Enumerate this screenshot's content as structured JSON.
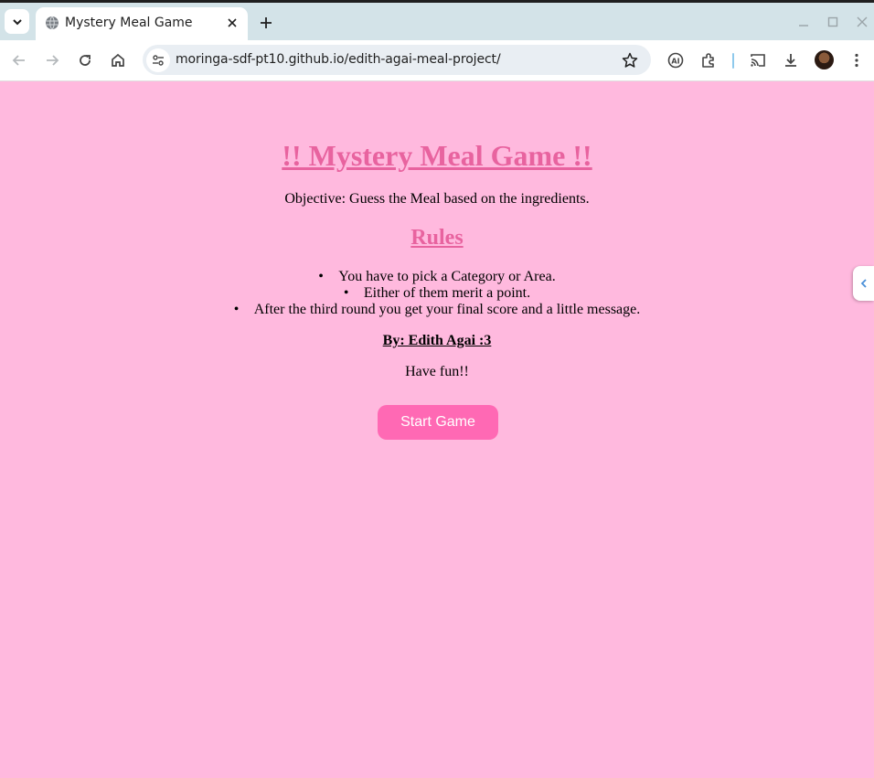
{
  "browser": {
    "tab_title": "Mystery Meal Game",
    "url": "moringa-sdf-pt10.github.io/edith-agai-meal-project/",
    "accent": "#d3e3e8"
  },
  "page": {
    "title": "!! Mystery Meal Game !!",
    "objective": "Objective: Guess the Meal based on the ingredients.",
    "rules_heading": "Rules",
    "rules": [
      "You have to pick a Category or Area.",
      "Either of them merit a point.",
      "After the third round you get your final score and a little message."
    ],
    "author": "By: Edith Agai :3",
    "closing": "Have fun!!",
    "start_button": "Start Game",
    "background_color": "#ffb9de",
    "heading_color": "#e8639f",
    "button_color": "#ff69b4"
  }
}
